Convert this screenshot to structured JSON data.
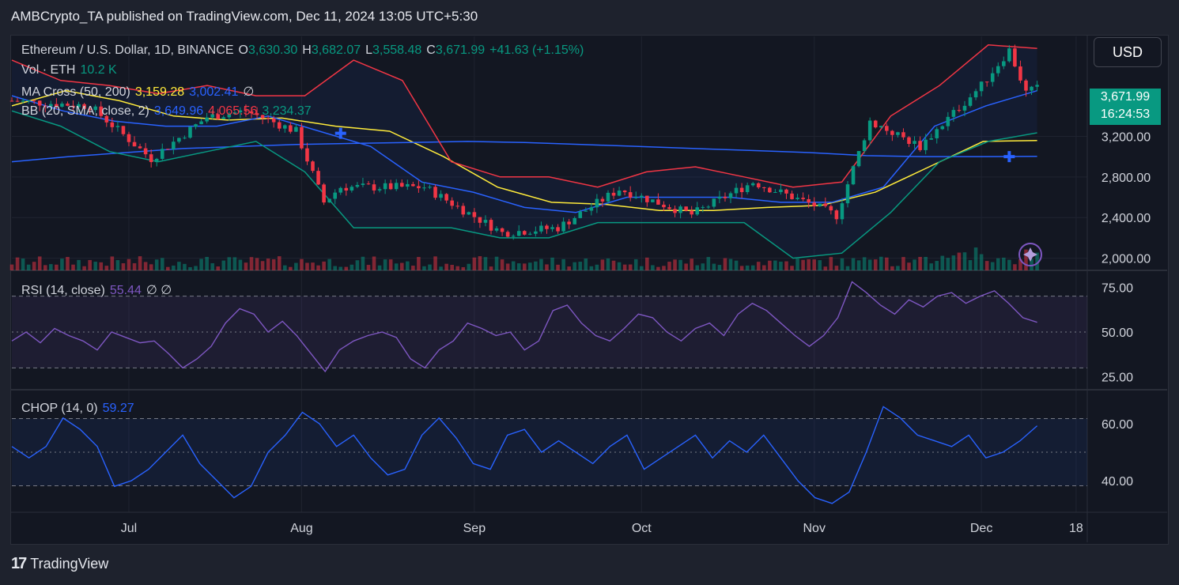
{
  "publisher": "AMBCrypto_TA published on TradingView.com, Dec 11, 2024 13:05 UTC+5:30",
  "brand": "TradingView",
  "currency_button": "USD",
  "legend": {
    "symbol": "Ethereum / U.S. Dollar, 1D, BINANCE",
    "o_label": "O",
    "o": "3,630.30",
    "h_label": "H",
    "h": "3,682.07",
    "l_label": "L",
    "l": "3,558.48",
    "c_label": "C",
    "c": "3,671.99",
    "change": "+41.63 (+1.15%)",
    "vol_label": "Vol · ETH",
    "vol": "10.2 K",
    "ma_label": "MA Cross (50, 200)",
    "ma50": "3,159.28",
    "ma200": "3,002.41",
    "ma_extra": "∅",
    "bb_label": "BB (20, SMA, close, 2)",
    "bb_mid": "3,649.96",
    "bb_up": "4,065.56",
    "bb_low": "3,234.37",
    "rsi_label": "RSI (14, close)",
    "rsi_val": "55.44",
    "rsi_extra": "∅ ∅",
    "chop_label": "CHOP (14, 0)",
    "chop_val": "59.27"
  },
  "price_tag": {
    "price": "3,671.99",
    "countdown": "16:24:53"
  },
  "colors": {
    "up": "#089981",
    "down": "#f23645",
    "ma50": "#ffeb3b",
    "ma200": "#2962ff",
    "bb_basis": "#2962ff",
    "bb_upper": "#f23645",
    "bb_lower": "#089981",
    "rsi": "#7e57c2",
    "chop": "#2962ff"
  },
  "chart_data": [
    {
      "type": "line",
      "title": "Ethereum / U.S. Dollar, 1D, BINANCE",
      "y_ticks": [
        "3,200.00",
        "2,800.00",
        "2,400.00",
        "2,000.00"
      ],
      "ylim": [
        1880,
        4200
      ],
      "x_ticks": [
        "Jul",
        "Aug",
        "Sep",
        "Oct",
        "Nov",
        "Dec",
        "18"
      ],
      "x_range": [
        "2024-06-10",
        "2024-12-20"
      ],
      "series": [
        {
          "name": "Close",
          "x": [
            "2024-06-10",
            "2024-06-24",
            "2024-07-05",
            "2024-07-15",
            "2024-07-22",
            "2024-07-31",
            "2024-08-05",
            "2024-08-08",
            "2024-08-23",
            "2024-09-06",
            "2024-09-16",
            "2024-09-27",
            "2024-10-10",
            "2024-10-21",
            "2024-11-01",
            "2024-11-05",
            "2024-11-11",
            "2024-11-20",
            "2024-12-01",
            "2024-12-06",
            "2024-12-09",
            "2024-12-11"
          ],
          "values": [
            3550,
            3500,
            2980,
            3390,
            3450,
            3250,
            2550,
            2700,
            2700,
            2250,
            2300,
            2680,
            2430,
            2750,
            2520,
            2420,
            3350,
            3100,
            3700,
            4050,
            3630,
            3671.99
          ]
        },
        {
          "name": "MA 50",
          "values": [
            3500,
            3650,
            3550,
            3400,
            3360,
            3380,
            3300,
            3250,
            3000,
            2700,
            2550,
            2530,
            2470,
            2470,
            2500,
            2520,
            2650,
            2900,
            3150,
            3159.28
          ]
        },
        {
          "name": "MA 200",
          "values": [
            2950,
            3000,
            3040,
            3080,
            3100,
            3120,
            3130,
            3140,
            3150,
            3140,
            3120,
            3100,
            3080,
            3060,
            3040,
            3010,
            3000,
            3000,
            3002.41
          ]
        },
        {
          "name": "BB upper",
          "values": [
            3950,
            3750,
            3700,
            3620,
            3700,
            3600,
            3600,
            3950,
            3750,
            2950,
            2800,
            2800,
            2700,
            2850,
            2900,
            2800,
            2700,
            2750,
            3400,
            3700,
            4100,
            4065.56
          ]
        },
        {
          "name": "BB basis",
          "values": [
            3600,
            3450,
            3350,
            3300,
            3300,
            3400,
            3250,
            3100,
            2750,
            2650,
            2500,
            2450,
            2600,
            2600,
            2600,
            2550,
            2550,
            2700,
            3300,
            3500,
            3649.96
          ]
        },
        {
          "name": "BB lower",
          "values": [
            3450,
            3300,
            3050,
            2950,
            3050,
            3150,
            2850,
            2300,
            2300,
            2300,
            2200,
            2200,
            2350,
            2350,
            2350,
            2350,
            2000,
            2050,
            2450,
            2950,
            3150,
            3234.37
          ]
        }
      ]
    },
    {
      "type": "line",
      "name": "RSI (14, close)",
      "y_ticks": [
        "75.00",
        "50.00",
        "25.00"
      ],
      "ylim": [
        20,
        80
      ],
      "bands": [
        70,
        50,
        30
      ],
      "values": [
        45,
        50,
        44,
        52,
        48,
        45,
        40,
        50,
        47,
        44,
        45,
        38,
        30,
        35,
        42,
        55,
        63,
        60,
        50,
        56,
        48,
        38,
        28,
        40,
        45,
        48,
        50,
        47,
        35,
        30,
        40,
        45,
        55,
        52,
        48,
        50,
        40,
        45,
        62,
        65,
        55,
        48,
        45,
        52,
        60,
        58,
        50,
        45,
        52,
        55,
        48,
        60,
        66,
        62,
        55,
        48,
        42,
        48,
        58,
        78,
        72,
        65,
        60,
        68,
        64,
        70,
        72,
        66,
        70,
        73,
        66,
        58,
        55.44
      ]
    },
    {
      "type": "line",
      "name": "CHOP (14, 0)",
      "y_ticks": [
        "60.00",
        "40.00"
      ],
      "ylim": [
        30,
        70
      ],
      "bands": [
        61.8,
        50,
        38.2
      ],
      "values": [
        52,
        48,
        52,
        62,
        58,
        52,
        38,
        40,
        44,
        50,
        56,
        46,
        40,
        34,
        38,
        50,
        56,
        64,
        60,
        52,
        56,
        48,
        42,
        44,
        56,
        62,
        55,
        46,
        44,
        56,
        58,
        50,
        54,
        50,
        46,
        52,
        56,
        44,
        48,
        52,
        56,
        48,
        54,
        50,
        56,
        48,
        40,
        34,
        32,
        36,
        50,
        66,
        62,
        56,
        54,
        52,
        56,
        48,
        50,
        54,
        59.27
      ]
    }
  ]
}
